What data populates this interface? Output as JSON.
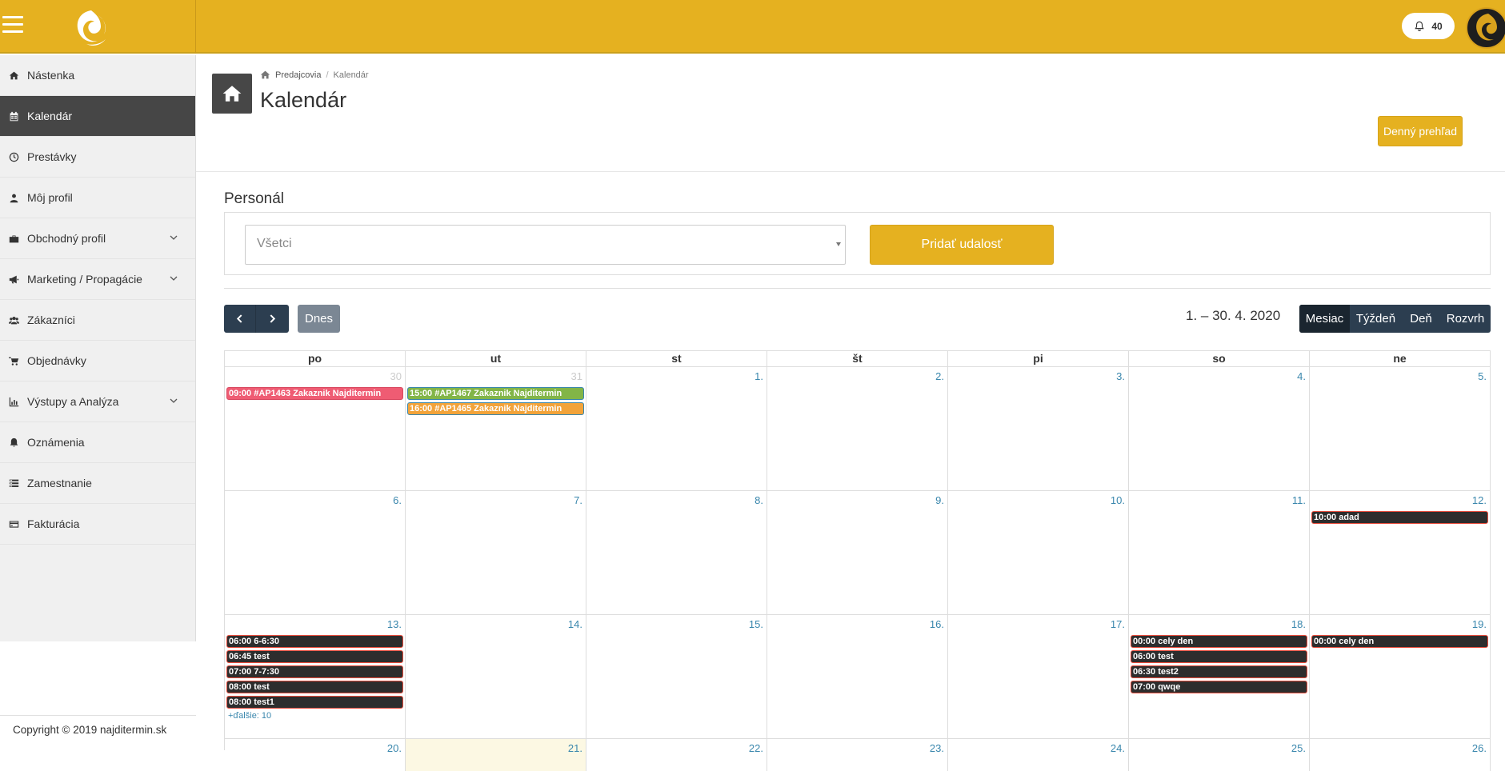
{
  "header": {
    "notification_count": "40",
    "brand_color": "#e5b120"
  },
  "sidebar": {
    "items": [
      {
        "label": "Nástenka",
        "icon": "home-icon"
      },
      {
        "label": "Kalendár",
        "icon": "calendar-icon",
        "active": true
      },
      {
        "label": "Prestávky",
        "icon": "clock-icon"
      },
      {
        "label": "Môj profil",
        "icon": "user-icon"
      },
      {
        "label": "Obchodný profil",
        "icon": "briefcase-icon",
        "expandable": true
      },
      {
        "label": "Marketing / Propagácie",
        "icon": "megaphone-icon",
        "expandable": true
      },
      {
        "label": "Zákazníci",
        "icon": "users-icon"
      },
      {
        "label": "Objednávky",
        "icon": "cart-icon"
      },
      {
        "label": "Výstupy a Analýza",
        "icon": "chart-icon",
        "expandable": true
      },
      {
        "label": "Oznámenia",
        "icon": "bell-icon"
      },
      {
        "label": "Zamestnanie",
        "icon": "list-icon"
      },
      {
        "label": "Fakturácia",
        "icon": "credit-card-icon"
      }
    ],
    "copyright": "Copyright © 2019 najditermin.sk"
  },
  "page": {
    "breadcrumb_home": "Predajcovia",
    "breadcrumb_sep": "/",
    "breadcrumb_current": "Kalendár",
    "title": "Kalendár",
    "daily_overview_button": "Denný prehľad"
  },
  "personal": {
    "label": "Personál",
    "select_value": "Všetci",
    "add_event_button": "Pridať udalosť"
  },
  "calendar": {
    "today_button": "Dnes",
    "range_title": "1. – 30. 4. 2020",
    "views": [
      "Mesiac",
      "Týždeň",
      "Deň",
      "Rozvrh"
    ],
    "active_view": "Mesiac",
    "weekdays": [
      "po",
      "ut",
      "st",
      "št",
      "pi",
      "so",
      "ne"
    ],
    "weeks": [
      [
        {
          "num": "30",
          "other": true,
          "events": [
            {
              "time": "09:00",
              "title": "#AP1463 Zakaznik Najditermin",
              "color": "pink"
            }
          ]
        },
        {
          "num": "31",
          "other": true,
          "events": [
            {
              "time": "15:00",
              "title": "#AP1467 Zakaznik Najditermin",
              "color": "green"
            },
            {
              "time": "16:00",
              "title": "#AP1465 Zakaznik Najditermin",
              "color": "orange"
            }
          ]
        },
        {
          "num": "1.",
          "events": []
        },
        {
          "num": "2.",
          "events": []
        },
        {
          "num": "3.",
          "events": []
        },
        {
          "num": "4.",
          "events": []
        },
        {
          "num": "5.",
          "events": []
        }
      ],
      [
        {
          "num": "6.",
          "events": []
        },
        {
          "num": "7.",
          "events": []
        },
        {
          "num": "8.",
          "events": []
        },
        {
          "num": "9.",
          "events": []
        },
        {
          "num": "10.",
          "events": []
        },
        {
          "num": "11.",
          "events": []
        },
        {
          "num": "12.",
          "events": [
            {
              "time": "10:00",
              "title": "adad",
              "color": "dark"
            }
          ]
        }
      ],
      [
        {
          "num": "13.",
          "events": [
            {
              "time": "06:00",
              "title": "6-6:30",
              "color": "dark"
            },
            {
              "time": "06:45",
              "title": "test",
              "color": "dark"
            },
            {
              "time": "07:00",
              "title": "7-7:30",
              "color": "dark"
            },
            {
              "time": "08:00",
              "title": "test",
              "color": "dark"
            },
            {
              "time": "08:00",
              "title": "test1",
              "color": "dark"
            }
          ],
          "more": "+ďalšie: 10"
        },
        {
          "num": "14.",
          "events": []
        },
        {
          "num": "15.",
          "events": []
        },
        {
          "num": "16.",
          "events": []
        },
        {
          "num": "17.",
          "events": []
        },
        {
          "num": "18.",
          "events": [
            {
              "time": "00:00",
              "title": "cely den",
              "color": "dark"
            },
            {
              "time": "06:00",
              "title": "test",
              "color": "dark"
            },
            {
              "time": "06:30",
              "title": "test2",
              "color": "dark"
            },
            {
              "time": "07:00",
              "title": "qwqe",
              "color": "dark"
            }
          ]
        },
        {
          "num": "19.",
          "events": [
            {
              "time": "00:00",
              "title": "cely den",
              "color": "dark"
            }
          ]
        }
      ],
      [
        {
          "num": "20.",
          "events": []
        },
        {
          "num": "21.",
          "today": true,
          "events": []
        },
        {
          "num": "22.",
          "events": []
        },
        {
          "num": "23.",
          "events": []
        },
        {
          "num": "24.",
          "events": []
        },
        {
          "num": "25.",
          "events": []
        },
        {
          "num": "26.",
          "events": []
        }
      ]
    ]
  }
}
